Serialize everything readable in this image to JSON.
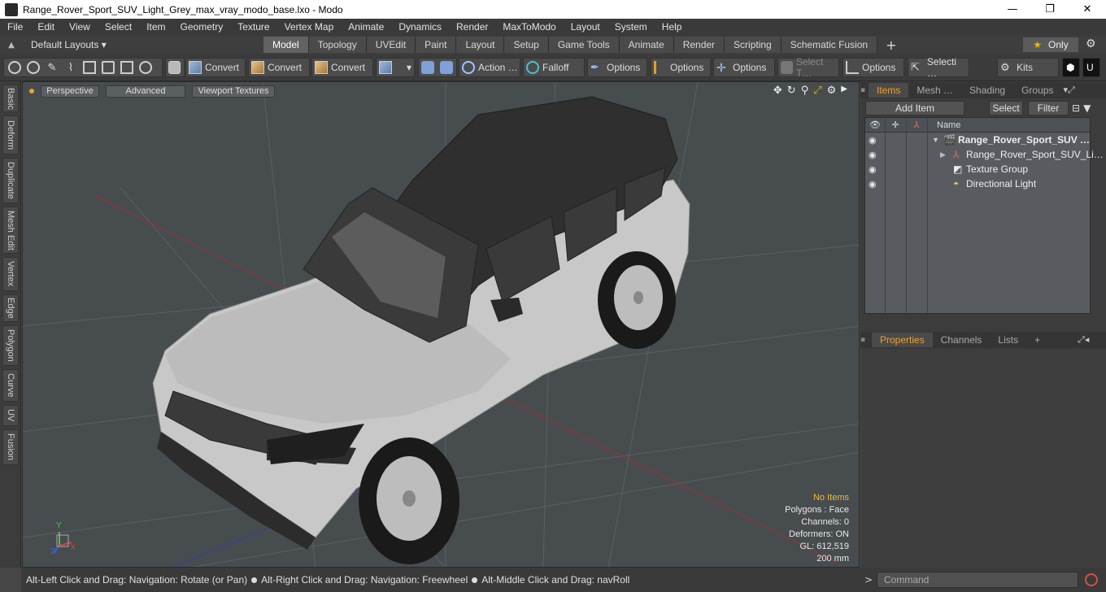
{
  "window": {
    "title": "Range_Rover_Sport_SUV_Light_Grey_max_vray_modo_base.lxo - Modo",
    "minimize": "—",
    "maximize": "❐",
    "close": "✕"
  },
  "menu": [
    "File",
    "Edit",
    "View",
    "Select",
    "Item",
    "Geometry",
    "Texture",
    "Vertex Map",
    "Animate",
    "Dynamics",
    "Render",
    "MaxToModo",
    "Layout",
    "System",
    "Help"
  ],
  "layoutbar": {
    "layouts_label": "Default Layouts ▾",
    "tabs": [
      "Model",
      "Topology",
      "UVEdit",
      "Paint",
      "Layout",
      "Setup",
      "Game Tools",
      "Animate",
      "Render",
      "Scripting",
      "Schematic Fusion"
    ],
    "active_tab": "Model",
    "plus": "+",
    "only_label": "Only",
    "star": "★"
  },
  "toolbar": {
    "convert1": "Convert",
    "convert2": "Convert",
    "convert3": "Convert",
    "action": "Action …",
    "falloff": "Falloff",
    "options1": "Options",
    "options2": "Options",
    "options3": "Options",
    "select_t": "Select T…",
    "options4": "Options",
    "selecti": "Selecti …",
    "kits": "Kits"
  },
  "lefttabs": [
    "Basic",
    "Deform",
    "Duplicate",
    "Mesh Edit",
    "Vertex",
    "Edge",
    "Polygon",
    "Curve",
    "UV",
    "Fusion"
  ],
  "viewport": {
    "perspective": "Perspective",
    "advanced": "Advanced",
    "textures": "Viewport Textures",
    "stats": {
      "items": "No Items",
      "polygons": "Polygons : Face",
      "channels": "Channels: 0",
      "deformers": "Deformers: ON",
      "gl": "GL: 612,519",
      "scale": "200 mm"
    },
    "axis_y": "Y",
    "axis_x": "X",
    "axis_z": "Z"
  },
  "statusbar": {
    "hint1": "Alt-Left Click and Drag: Navigation: Rotate (or Pan)",
    "hint2": "Alt-Right Click and Drag: Navigation: Freewheel",
    "hint3": "Alt-Middle Click and Drag: navRoll"
  },
  "items_panel": {
    "tabs": [
      "Items",
      "Mesh …",
      "Shading",
      "Groups"
    ],
    "add_item": "Add Item",
    "select": "Select",
    "filter": "Filter",
    "name_col": "Name",
    "rows": [
      {
        "label": "Range_Rover_Sport_SUV …",
        "bold": true
      },
      {
        "label": "Range_Rover_Sport_SUV_Li…",
        "bold": false
      },
      {
        "label": "Texture Group",
        "bold": false
      },
      {
        "label": "Directional Light",
        "bold": false
      }
    ]
  },
  "properties_panel": {
    "tabs": [
      "Properties",
      "Channels",
      "Lists"
    ],
    "plus": "+"
  },
  "command": {
    "placeholder": "Command",
    "prompt": ">"
  },
  "colors": {
    "accent": "#f0a030",
    "viewport_bg": "#474c4f",
    "panel_bg": "#3c3c3c"
  }
}
